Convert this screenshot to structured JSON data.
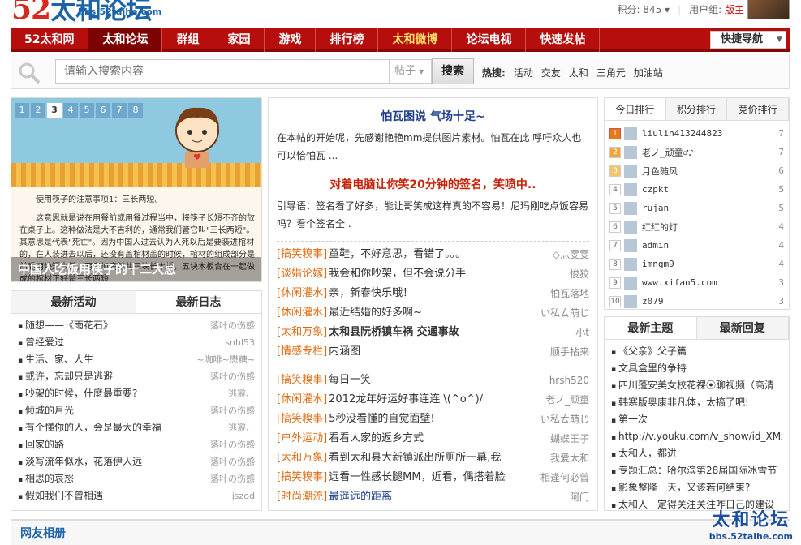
{
  "site": {
    "logo_num": "52",
    "logo_cn": "太和论坛",
    "logo_url": "bbs.52taihe.com"
  },
  "user": {
    "points": "积分: 845",
    "group_label": "用户组:",
    "group_value": "版主"
  },
  "nav": {
    "items": [
      "52太和网",
      "太和论坛",
      "群组",
      "家园",
      "游戏",
      "排行榜",
      "太和微博",
      "论坛电视",
      "快速发帖"
    ],
    "quick": "快捷导航"
  },
  "search": {
    "placeholder": "请输入搜索内容",
    "type": "帖子",
    "button": "搜索",
    "hot_label": "热搜:",
    "hot": [
      "活动",
      "交友",
      "太和",
      "三角元",
      "加油站"
    ]
  },
  "slider": {
    "pages": [
      "1",
      "2",
      "3",
      "4",
      "5",
      "6",
      "7",
      "8"
    ],
    "text1": "使用筷子的注意事项1：三长两短。",
    "text2": "这意思就是说在用餐前或用餐过程当中，将筷子长短不齐的放在桌子上。这种做法是大不吉利的，通常我们管它叫\"三长两短\"。其意思是代表\"死亡\"。因为中国人过去认为人死以后是要装进棺材的，在人装进去以后，还没有盖棺材盖的时候，棺材的组成部分是前后两块短木板，两旁加底部共三块长木板，五块木板合在一起做成的棺材正好是三长两短",
    "caption": "中国人吃饭用筷子的十二大忌"
  },
  "activity": {
    "tabs": [
      "最新活动",
      "最新日志"
    ],
    "items": [
      {
        "t": "随想——《雨花石》",
        "a": "落叶の伤感"
      },
      {
        "t": "曾经爱过",
        "a": "snhl53"
      },
      {
        "t": "生活、家、人生",
        "a": "~咖啡~懋糖~"
      },
      {
        "t": "或许，忘却只是逃避",
        "a": "落叶の伤感"
      },
      {
        "t": "吵架的时候，什麼最重要?",
        "a": "逃避、"
      },
      {
        "t": "倾城的月光",
        "a": "落叶の伤感"
      },
      {
        "t": "有个懂你的人，会是最大的幸福",
        "a": "逃避、"
      },
      {
        "t": "回家的路",
        "a": "落叶の伤感"
      },
      {
        "t": "淡写流年似水，花落伊人远",
        "a": "落叶の伤感"
      },
      {
        "t": "相思的哀愁",
        "a": "落叶の伤感"
      },
      {
        "t": "假如我们不曾相遇",
        "a": "jszod"
      }
    ]
  },
  "center": {
    "headline": "怕瓦图说 气场十足~",
    "summary1": "在本帖的开始呢，先感谢艳艳mm提供图片素材。怕瓦在此 呼吁众人也可以恰怕瓦 ...",
    "headline2": "对着电脑让你笑20分钟的签名，笑喷中..",
    "summary2": "引导语：签名看了好多，能让哥笑成这样真的不容易！尼玛刚吃点饭容易吗？看个签名全 .",
    "threads1": [
      {
        "c": "[搞笑糗事]",
        "t": "童鞋，不好意思，看错了。。。",
        "a": "◇灬雯雯"
      },
      {
        "c": "[谈婚论嫁]",
        "t": "我会和你吵架，但不会说分手",
        "a": "悛狡"
      },
      {
        "c": "[休闲灌水]",
        "t": "亲，新春快乐哦！",
        "a": "怕瓦落地"
      },
      {
        "c": "[休闲灌水]",
        "t": "最近结婚的好多啊~",
        "a": "い私ㄊ萌じ"
      },
      {
        "c": "[太和万象]",
        "t": "太和县阮桥镇车祸 交通事故",
        "a": "小t",
        "bold": true
      },
      {
        "c": "[情感专栏]",
        "t": "内涵图",
        "a": "顺手拈来"
      }
    ],
    "threads2": [
      {
        "c": "[搞笑糗事]",
        "t": "每日一笑",
        "a": "hrsh520"
      },
      {
        "c": "[休闲灌水]",
        "t": "2012龙年好运好事连连 \\(^o^)/",
        "a": "老ノ_顽童"
      },
      {
        "c": "[搞笑糗事]",
        "t": "5秒没看懂的自觉面壁!",
        "a": "い私ㄊ萌じ"
      },
      {
        "c": "[户外运动]",
        "t": "看看人家的返乡方式",
        "a": "蝴蝶王子"
      },
      {
        "c": "[太和万象]",
        "t": "看到太和县大新镇派出所厕所一幕,我",
        "a": "我爱太和"
      },
      {
        "c": "[搞笑糗事]",
        "t": "远看一性感长腿MM，近看，偶搭着脸",
        "a": "相逢何必曾"
      },
      {
        "c": "[时尚潮流]",
        "t": "最遥远的距离",
        "a": "阿门",
        "blue": true
      }
    ]
  },
  "rank": {
    "tabs": [
      "今日排行",
      "积分排行",
      "竞价排行"
    ],
    "items": [
      {
        "n": "1",
        "name": "liulin413244823",
        "c": "7"
      },
      {
        "n": "2",
        "name": "老ノ_顽童♂♪",
        "c": "7"
      },
      {
        "n": "3",
        "name": "月色随风",
        "c": "6"
      },
      {
        "n": "4",
        "name": "czpkt",
        "c": "5"
      },
      {
        "n": "5",
        "name": "rujan",
        "c": "5"
      },
      {
        "n": "6",
        "name": "红红的灯",
        "c": "4"
      },
      {
        "n": "7",
        "name": "admin",
        "c": "4"
      },
      {
        "n": "8",
        "name": "imnqm9",
        "c": "4"
      },
      {
        "n": "9",
        "name": "www.xifan5.com",
        "c": "3"
      },
      {
        "n": "10",
        "name": "z079",
        "c": "3"
      }
    ]
  },
  "newest": {
    "tabs": [
      "最新主题",
      "最新回复"
    ],
    "items": [
      "《父亲》父子篇",
      "文具盒里的争持",
      "四川蓬安美女校花裸⦿聊视频（高清",
      "韩寒版奥康非凡体，太搞了吧!",
      "第一次",
      "http://v.youku.com/v_show/id_XMz",
      "太和人，都进",
      "专题汇总：哈尔滨第28届国际冰雪节",
      "影象整隆一天，又该若何结束?",
      "太和人一定得关注关注咋日己的建设"
    ]
  },
  "footer": {
    "title": "网友相册",
    "wm1": "太和论坛",
    "wm2": "bbs.52taihe.com"
  }
}
